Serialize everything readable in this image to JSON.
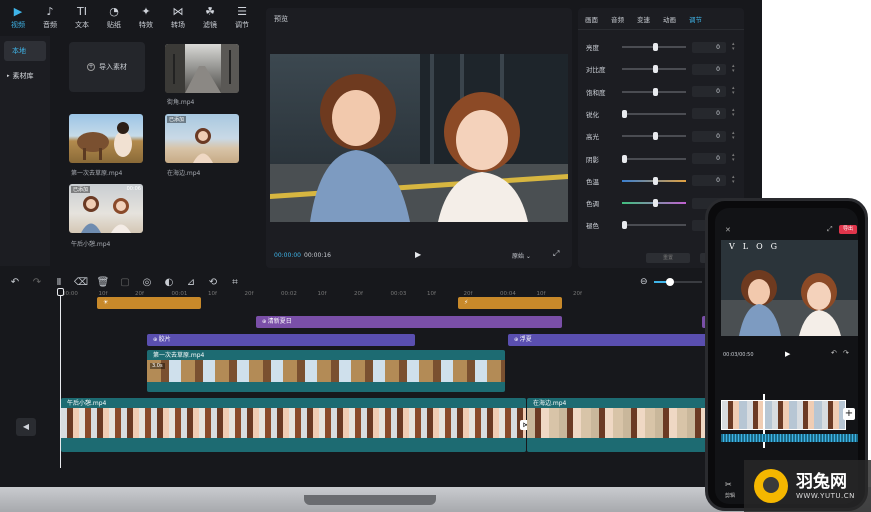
{
  "tools": [
    {
      "label": "视频",
      "icon": "▶",
      "active": true
    },
    {
      "label": "音频",
      "icon": "♪"
    },
    {
      "label": "文本",
      "icon": "TI"
    },
    {
      "label": "贴纸",
      "icon": "◔"
    },
    {
      "label": "特效",
      "icon": "✦"
    },
    {
      "label": "转场",
      "icon": "⋈"
    },
    {
      "label": "滤镜",
      "icon": "☘"
    },
    {
      "label": "调节",
      "icon": "☰"
    }
  ],
  "left_nav": {
    "local": "本地",
    "library": "素材库"
  },
  "media": {
    "import_label": "导入素材",
    "items": [
      {
        "name": "街角.mp4"
      },
      {
        "name": "第一次去草原.mp4"
      },
      {
        "name": "在海边.mp4",
        "badge": "已添加"
      },
      {
        "name": "午后小憩.mp4",
        "badge": "已添加",
        "duration": "00:06"
      }
    ]
  },
  "preview": {
    "title": "预览",
    "current_time": "00:00:00",
    "total_time": "00:00:16",
    "ratio": "原始"
  },
  "adjust": {
    "tabs": [
      "画面",
      "音频",
      "变速",
      "动画",
      "调节"
    ],
    "active_tab": "调节",
    "rows": [
      {
        "label": "亮度",
        "value": "0",
        "pos": 0.5
      },
      {
        "label": "对比度",
        "value": "0",
        "pos": 0.5
      },
      {
        "label": "饱和度",
        "value": "0",
        "pos": 0.5
      },
      {
        "label": "锐化",
        "value": "0",
        "pos": 0
      },
      {
        "label": "高光",
        "value": "0",
        "pos": 0.5
      },
      {
        "label": "阴影",
        "value": "0",
        "pos": 0
      },
      {
        "label": "色温",
        "value": "0",
        "pos": 0.5
      },
      {
        "label": "色调",
        "value": "0",
        "pos": 0.5
      },
      {
        "label": "褪色",
        "value": "0",
        "pos": 0
      }
    ],
    "reset_label": "重置"
  },
  "timeline": {
    "ruler": [
      "00:00",
      "10f",
      "20f",
      "00:01",
      "10f",
      "20f",
      "00:02",
      "10f",
      "20f",
      "00:03",
      "10f",
      "20f",
      "00:04",
      "10f",
      "20f"
    ],
    "tracks": {
      "sticker_label": "",
      "text_track_label": "清新夏日",
      "filter_left": "胶片",
      "filter_right": "浮夏",
      "overlay_clip": "第一次去草原.mp4",
      "overlay_duration": "3.0s",
      "main_clip_1": "午后小憩.mp4",
      "main_clip_2": "在海边.mp4"
    }
  },
  "phone": {
    "title": "VLOG",
    "export": "导出",
    "time": "00:03/00:50",
    "cut_label": "剪辑"
  },
  "watermark": {
    "brand": "羽兔网",
    "url": "WWW.YUTU.CN"
  },
  "colors": {
    "accent": "#3fb4e8",
    "orange_track": "#c8892a",
    "purple_track": "#7a4fa8",
    "blue_track": "#5a4fb0",
    "teal_track": "#1d6b72"
  }
}
